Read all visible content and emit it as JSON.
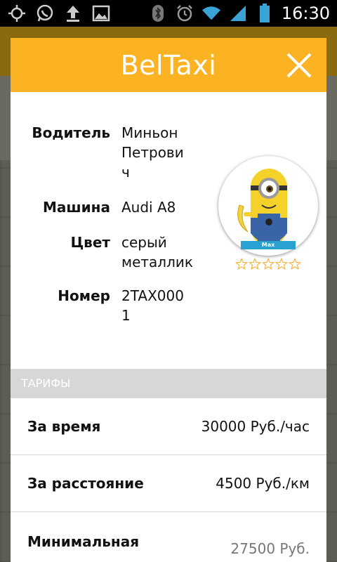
{
  "status_bar": {
    "time": "16:30",
    "icons_left": [
      "gps-icon",
      "whatsapp-icon",
      "upload-icon",
      "image-icon"
    ],
    "icons_right": [
      "bluetooth-icon",
      "alarm-icon",
      "wifi-icon",
      "signal-icon",
      "battery-icon"
    ]
  },
  "dialog": {
    "title": "BelTaxi",
    "driver": {
      "label": "Водитель",
      "value": "Миньон\nПетрови\nч"
    },
    "car": {
      "label": "Машина",
      "value": "Audi A8"
    },
    "color": {
      "label": "Цвет",
      "value": "серый\nметаллик"
    },
    "plate": {
      "label": "Номер",
      "value": "2TAX000\n1"
    },
    "avatar_name": "Max",
    "rating": {
      "stars_total": 5,
      "stars_filled": 0
    },
    "tariffs": {
      "header": "ТАРИФЫ",
      "rows": [
        {
          "label": "За время",
          "value": "30000 Руб./час"
        },
        {
          "label": "За расстояние",
          "value": "4500 Руб./км"
        },
        {
          "label": "Минимальная",
          "value": "27500 Руб."
        }
      ]
    }
  },
  "colors": {
    "accent": "#fbb324",
    "tariff_header_bg": "#d7d7d7",
    "avatar_badge": "#2aa1d0"
  }
}
